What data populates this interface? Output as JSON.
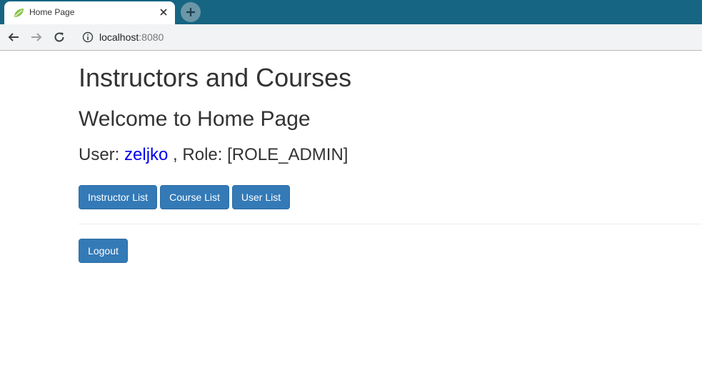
{
  "browser": {
    "tab": {
      "title": "Home Page",
      "favicon": "spring-leaf-icon"
    },
    "toolbar": {
      "url_host": "localhost",
      "url_port": ":8080"
    }
  },
  "page": {
    "heading": "Instructors and Courses",
    "welcome": "Welcome to Home Page",
    "user_prefix": "User:",
    "username": "zeljko",
    "role_text": ", Role: [ROLE_ADMIN]",
    "buttons": {
      "instructor_list": "Instructor List",
      "course_list": "Course List",
      "user_list": "User List",
      "logout": "Logout"
    }
  },
  "colors": {
    "tabstrip": "#166582",
    "primary_button": "#337ab7",
    "link": "#0000ee",
    "text": "#333333"
  }
}
